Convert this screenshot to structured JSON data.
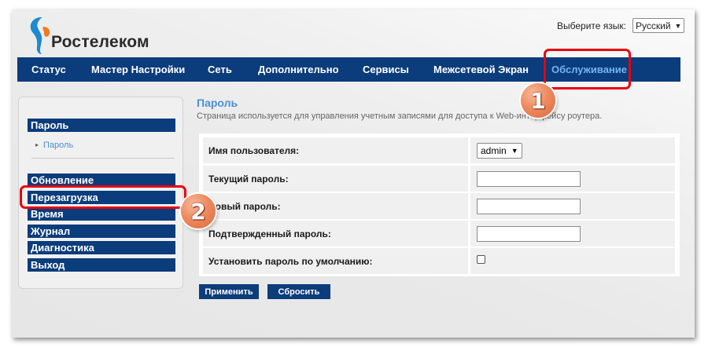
{
  "logo": {
    "text": "Ростелеком"
  },
  "language": {
    "label": "Выберите язык:",
    "value": "Русский"
  },
  "nav": {
    "items": [
      {
        "label": "Статус"
      },
      {
        "label": "Мастер Настройки"
      },
      {
        "label": "Сеть"
      },
      {
        "label": "Дополнительно"
      },
      {
        "label": "Сервисы"
      },
      {
        "label": "Межсетевой Экран"
      },
      {
        "label": "Обслуживание"
      }
    ]
  },
  "sidebar": {
    "section1": "Пароль",
    "sub": "Пароль",
    "items": [
      {
        "label": "Обновление"
      },
      {
        "label": "Перезагрузка"
      },
      {
        "label": "Время"
      },
      {
        "label": "Журнал"
      },
      {
        "label": "Диагностика"
      },
      {
        "label": "Выход"
      }
    ]
  },
  "content": {
    "title": "Пароль",
    "description": "Страница используется для управления учетным записями для доступа к Web-интерфейсу роутера.",
    "rows": [
      {
        "label": "Имя пользователя:",
        "value": "admin"
      },
      {
        "label": "Текущий пароль:",
        "value": ""
      },
      {
        "label": "Новый пароль:",
        "value": ""
      },
      {
        "label": "Подтвержденный пароль:",
        "value": ""
      },
      {
        "label": "Установить пароль по умолчанию:",
        "checked": false
      }
    ],
    "apply": "Применить",
    "reset": "Сбросить"
  },
  "markers": {
    "m1": "1",
    "m2": "2"
  },
  "colors": {
    "nav": "#0b3c7b",
    "active": "#71b6f4",
    "highlight": "#e8000d",
    "marker": "#ee8a5f"
  }
}
